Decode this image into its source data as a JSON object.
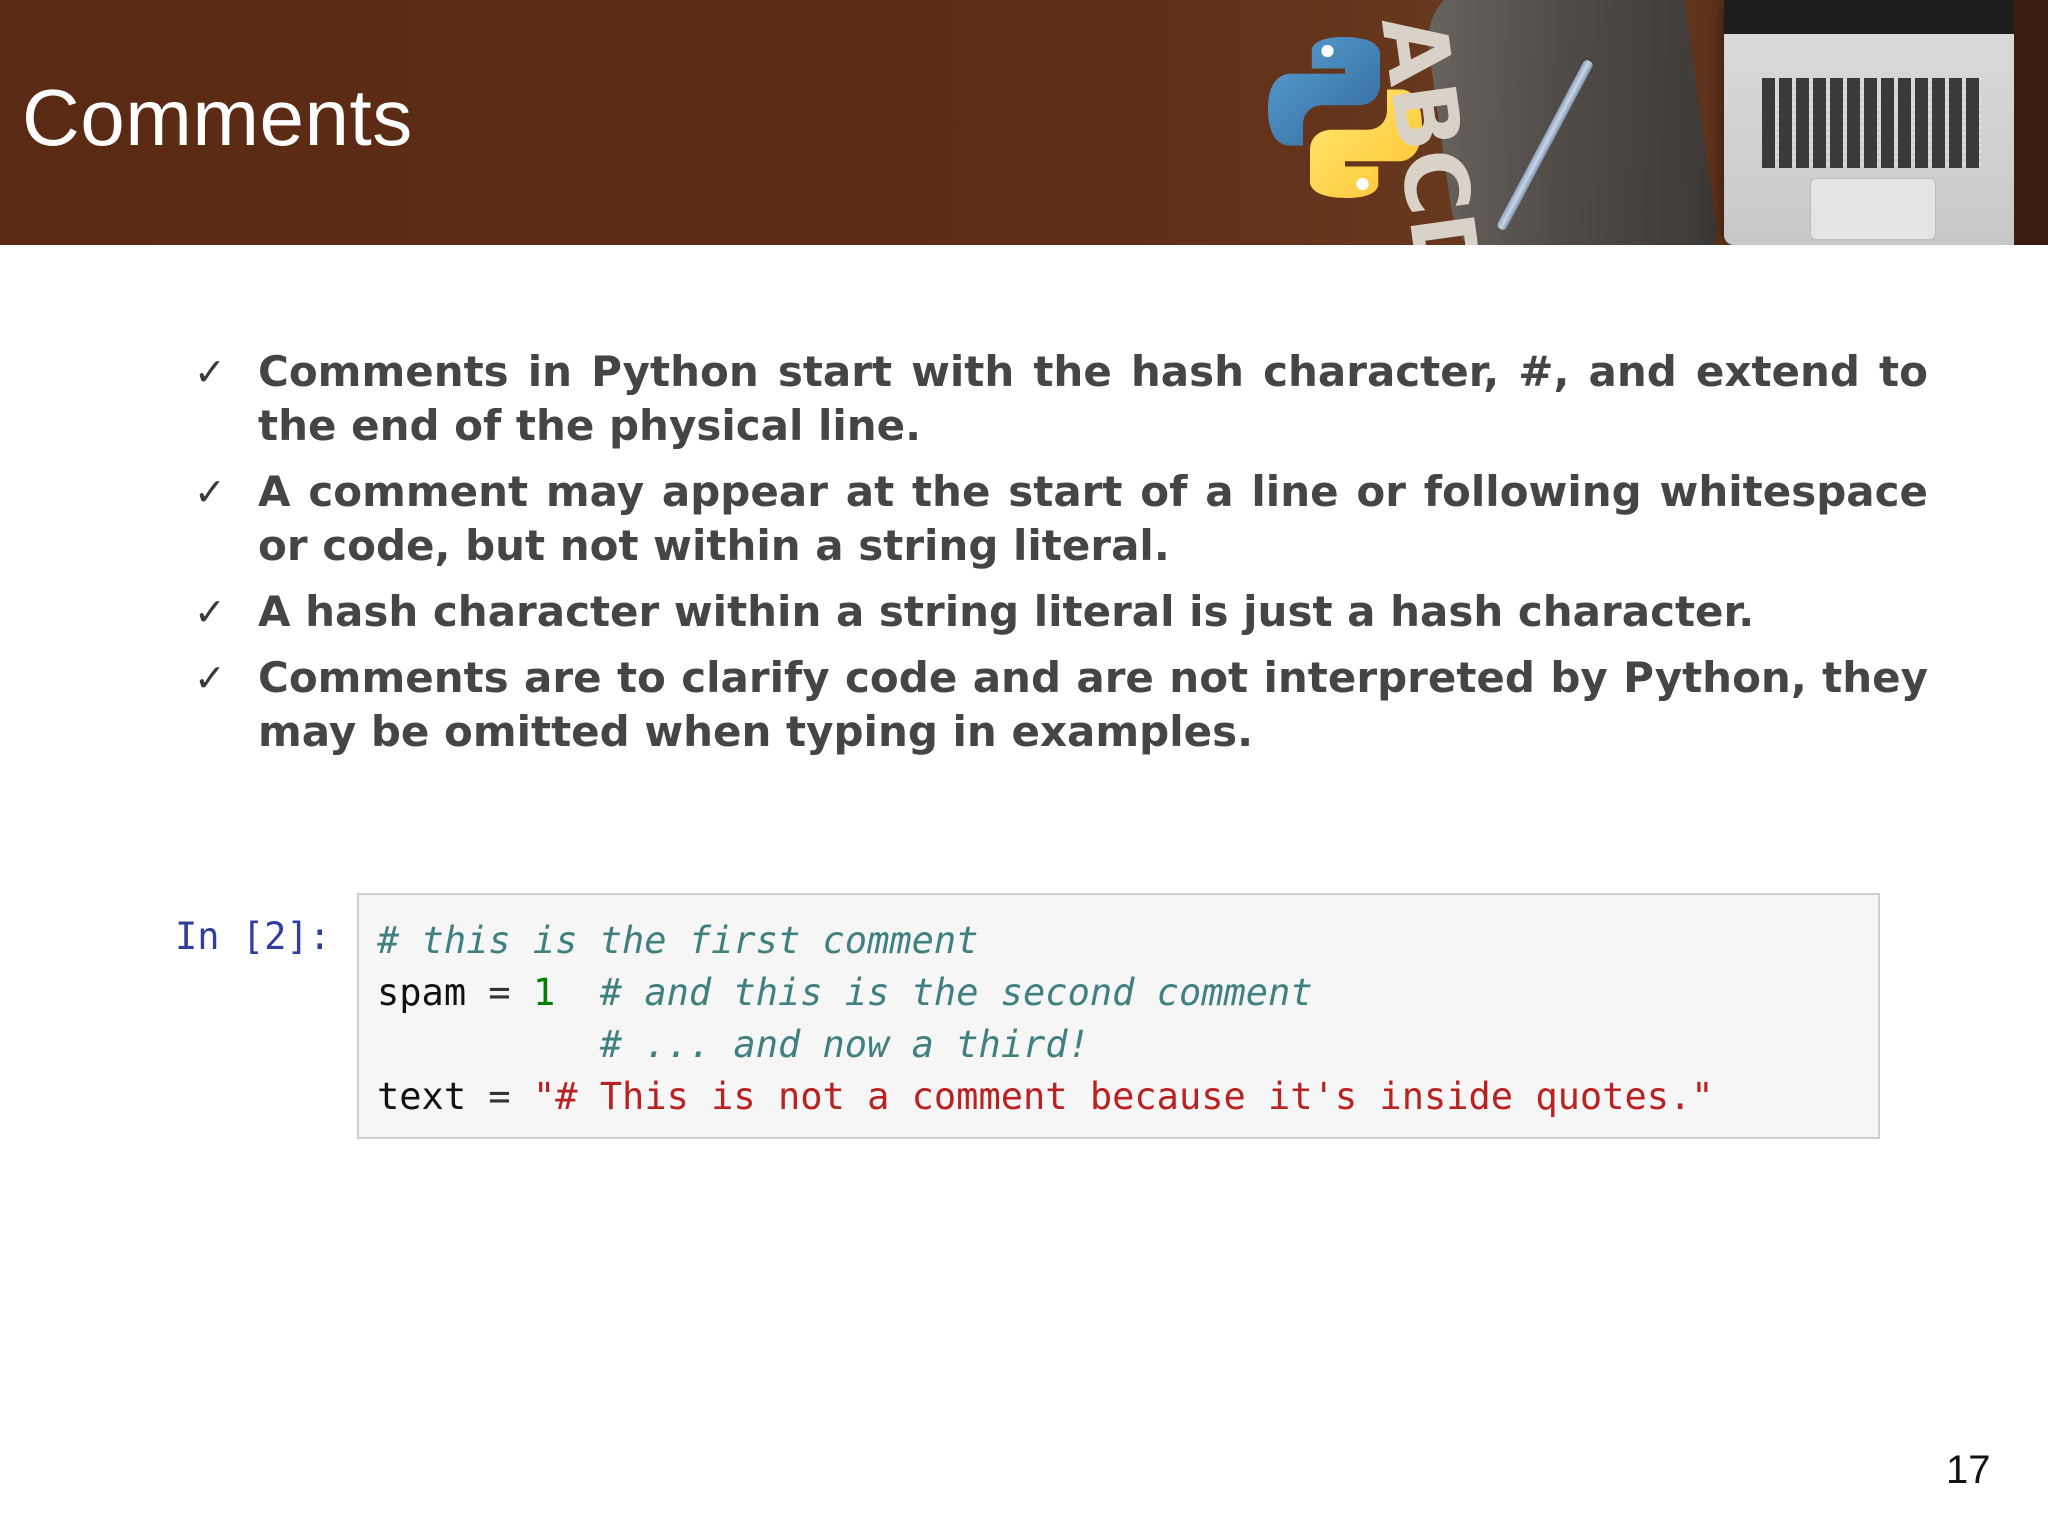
{
  "slide": {
    "title": "Comments",
    "page_number": "17",
    "decor": {
      "header_bg": "#5e2e17",
      "pillow_letters": "ABCDEFGHIJ",
      "logo": "python-logo-icon"
    }
  },
  "bullets": {
    "check_glyph": "✓",
    "items": [
      "Comments in Python start with the hash character, #, and extend to the end of the physical line.",
      "A comment may appear at the start of a line or following whitespace or code, but not within a string literal.",
      "A hash character within a string literal is just a hash character.",
      "Comments are to clarify code and are not interpreted by Python, they may be omitted when typing in examples."
    ]
  },
  "code": {
    "prompt": "In [2]:",
    "line1_comment": "# this is the first comment",
    "line2_var": "spam",
    "line2_eq": " = ",
    "line2_num": "1",
    "line2_comment": "# and this is the second comment",
    "line3_comment": "# ... and now a third!",
    "line4_var": "text",
    "line4_eq": " = ",
    "line4_str": "\"# This is not a comment because it's inside quotes.\"",
    "colors": {
      "comment": "#408080",
      "number": "#008000",
      "string": "#ba2121",
      "prompt": "#303f9f"
    }
  }
}
